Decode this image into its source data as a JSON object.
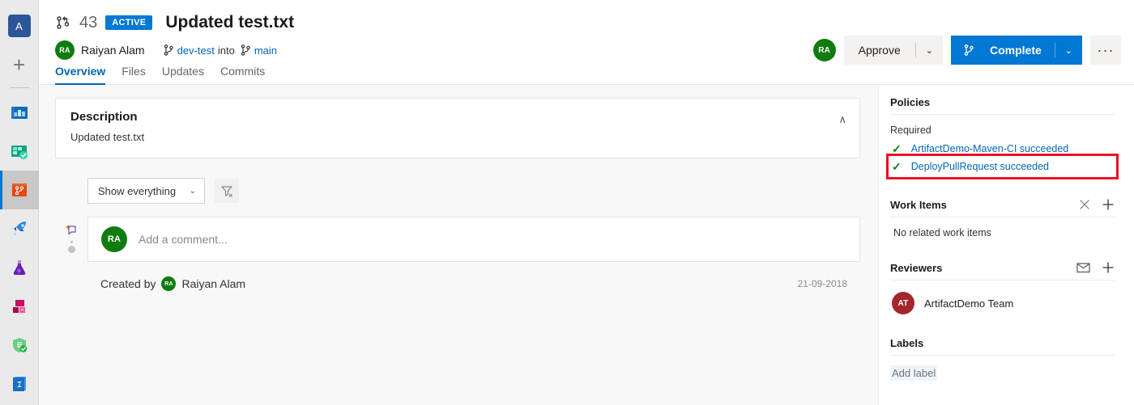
{
  "rail": {
    "project_avatar_initial": "A",
    "items": [
      {
        "name": "project-avatar",
        "label": "A",
        "icon": "project-avatar-icon"
      },
      {
        "name": "new-item",
        "label": "+",
        "icon": "plus-icon"
      },
      {
        "name": "overview",
        "label": "Overview",
        "icon": "overview-icon"
      },
      {
        "name": "boards",
        "label": "Boards",
        "icon": "boards-icon"
      },
      {
        "name": "repos",
        "label": "Repos",
        "icon": "repos-icon"
      },
      {
        "name": "pipelines",
        "label": "Pipelines",
        "icon": "pipelines-icon"
      },
      {
        "name": "test-plans",
        "label": "Test Plans",
        "icon": "test-plans-icon"
      },
      {
        "name": "artifacts",
        "label": "Artifacts",
        "icon": "artifacts-icon"
      },
      {
        "name": "security",
        "label": "Security",
        "icon": "shield-check-icon"
      },
      {
        "name": "analytics",
        "label": "Analytics",
        "icon": "analytics-icon"
      }
    ]
  },
  "header": {
    "pr_id": "43",
    "status_badge": "ACTIVE",
    "title": "Updated test.txt",
    "author": {
      "name": "Raiyan Alam",
      "initials": "RA"
    },
    "source_branch": "dev-test",
    "into_text": "into",
    "target_branch": "main",
    "tabs": [
      {
        "label": "Overview",
        "active": true
      },
      {
        "label": "Files",
        "active": false
      },
      {
        "label": "Updates",
        "active": false
      },
      {
        "label": "Commits",
        "active": false
      }
    ],
    "actions": {
      "reviewer_avatar_initials": "RA",
      "approve_label": "Approve",
      "approve_caret": "⌄",
      "complete_label": "Complete",
      "complete_caret": "⌄",
      "more_label": "···"
    }
  },
  "content": {
    "description": {
      "title": "Description",
      "text": "Updated test.txt",
      "collapse_caret": "∧"
    },
    "filter": {
      "dropdown_value": "Show everything",
      "dropdown_caret": "⌄",
      "clear_filter_icon": "filter-clear-icon"
    },
    "comment": {
      "avatar_initials": "RA",
      "placeholder": "Add a comment..."
    },
    "activity": {
      "created_by_label": "Created by",
      "author_initials": "RA",
      "author_name": "Raiyan Alam",
      "date": "21-09-2018"
    }
  },
  "sidebar": {
    "policies": {
      "title": "Policies",
      "required_label": "Required",
      "items": [
        {
          "text": "ArtifactDemo-Maven-CI succeeded",
          "status": "succeeded",
          "highlighted": false
        },
        {
          "text": "DeployPullRequest succeeded",
          "status": "succeeded",
          "highlighted": true
        }
      ]
    },
    "work_items": {
      "title": "Work Items",
      "empty_text": "No related work items",
      "close_icon": "close-icon",
      "add_icon": "plus-icon"
    },
    "reviewers": {
      "title": "Reviewers",
      "mail_icon": "mail-icon",
      "add_icon": "plus-icon",
      "list": [
        {
          "name": "ArtifactDemo Team",
          "initials": "AT"
        }
      ]
    },
    "labels": {
      "title": "Labels",
      "add_label": "Add label"
    }
  },
  "colors": {
    "accent": "#0078d4",
    "link": "#0067b8",
    "success": "#107c10",
    "highlight_border": "#e81123",
    "avatar_green": "#107c10",
    "avatar_red": "#a4262c"
  }
}
